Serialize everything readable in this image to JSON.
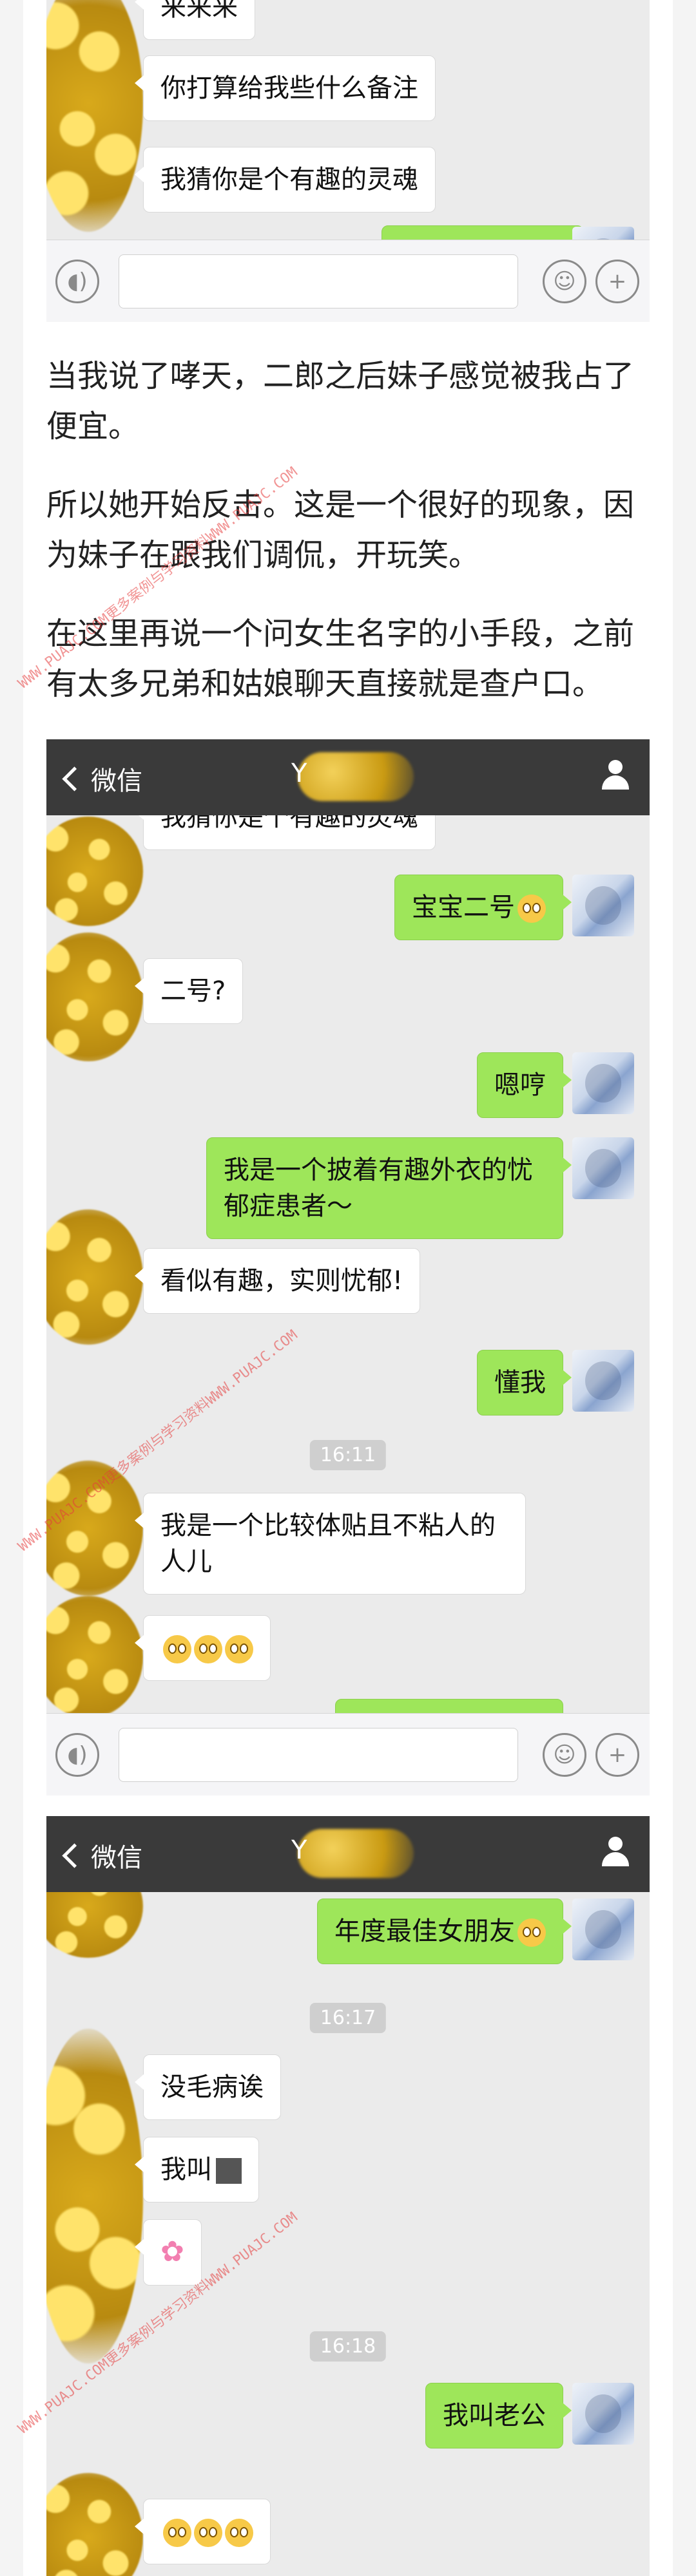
{
  "screenshot1": {
    "messages": [
      {
        "side": "left",
        "text": "来来来"
      },
      {
        "side": "left",
        "text": "你打算给我些什么备注"
      },
      {
        "side": "left",
        "text": "我猜你是个有趣的灵魂"
      }
    ]
  },
  "paragraphs": [
    "当我说了哮天，二郎之后妹子感觉被我占了便宜。",
    "所以她开始反击。这是一个很好的现象，因为妹子在跟我们调侃，开玩笑。",
    "在这里再说一个问女生名字的小手段，之前有太多兄弟和姑娘聊天直接就是查户口。"
  ],
  "watermark": "WWW.PUAJC.COM更多案例与学习资料WWW.PUAJC.COM",
  "screenshot2": {
    "back_label": "微信",
    "contact_initial": "Y",
    "partial_top": "我猜你是个有趣的灵魂",
    "messages": [
      {
        "side": "right",
        "text": "宝宝二号"
      },
      {
        "side": "left",
        "text": "二号?"
      },
      {
        "side": "right",
        "text": "嗯哼"
      },
      {
        "side": "right",
        "text": "我是一个披着有趣外衣的忧郁症患者～"
      },
      {
        "side": "left",
        "text": "看似有趣，实则忧郁!"
      },
      {
        "side": "right",
        "text": "懂我"
      },
      {
        "side": "left",
        "text": "我是一个比较体贴且不粘人的人儿"
      }
    ],
    "time": "16:11"
  },
  "screenshot3": {
    "back_label": "微信",
    "contact_initial": "Y",
    "messages": [
      {
        "side": "right",
        "text": "年度最佳女朋友"
      },
      {
        "side": "left",
        "text": "没毛病诶"
      },
      {
        "side": "left",
        "text": "我叫"
      },
      {
        "side": "right",
        "text": "我叫老公"
      }
    ],
    "times": [
      "16:17",
      "16:18"
    ]
  },
  "icons": [
    "voice-icon",
    "emoji-icon",
    "plus-icon",
    "person-icon",
    "chevron-left-icon"
  ]
}
